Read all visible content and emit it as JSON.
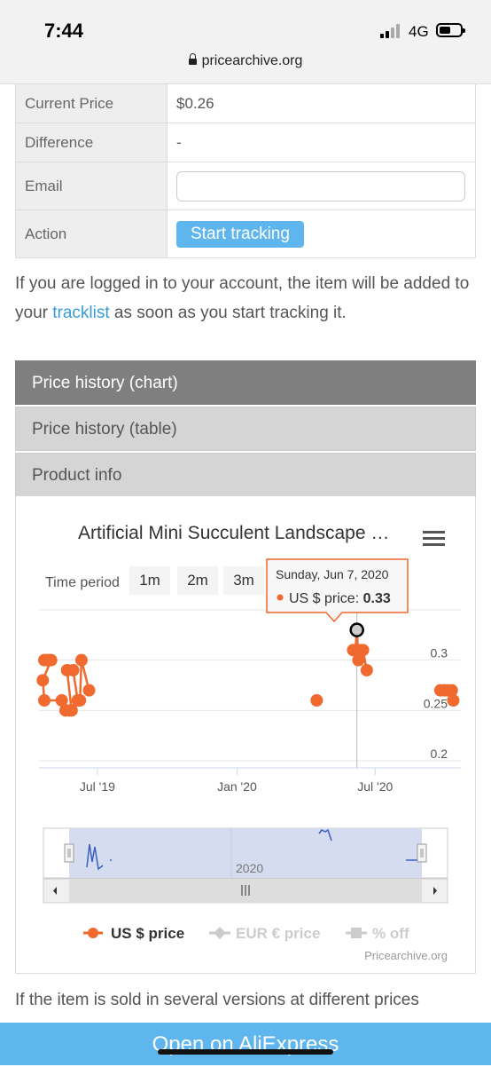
{
  "status": {
    "time": "7:44",
    "network": "4G",
    "url": "pricearchive.org"
  },
  "info_table": [
    {
      "label": "Current Price",
      "value": "$0.26"
    },
    {
      "label": "Difference",
      "value": "-"
    },
    {
      "label": "Email",
      "value": ""
    },
    {
      "label": "Action",
      "button": "Start tracking"
    }
  ],
  "intro": {
    "before": "If you are logged in to your account, the item will be added to your ",
    "link": "tracklist",
    "after": " as soon as you start tracking it."
  },
  "tabs": [
    "Price history (chart)",
    "Price history (table)",
    "Product info"
  ],
  "chart": {
    "title": "Artificial Mini Succulent Landscape …",
    "time_period_label": "Time period",
    "periods": [
      "1m",
      "2m",
      "3m"
    ],
    "tooltip": {
      "date": "Sunday, Jun 7, 2020",
      "series": "US $ price: ",
      "value": "0.33"
    },
    "navigator_label": "2020",
    "legend": [
      "US $ price",
      "EUR € price",
      "% off"
    ],
    "credit": "Pricearchive.org",
    "colors": {
      "us": "#f0692f",
      "inactive": "#cccccc",
      "navigator": "#d6dcf0",
      "navline": "#3b5fbf"
    }
  },
  "chart_data": {
    "type": "scatter",
    "title": "Artificial Mini Succulent Landscape …",
    "x_tick_labels": [
      "Jul '19",
      "Jan '20",
      "Jul '20"
    ],
    "y_tick_labels": [
      "0.2",
      "0.25",
      "0.3"
    ],
    "ylim": [
      0.2,
      0.35
    ],
    "series": [
      {
        "name": "US $ price",
        "points": [
          [
            "2019-04-22",
            0.3
          ],
          [
            "2019-04-25",
            0.3
          ],
          [
            "2019-04-28",
            0.3
          ],
          [
            "2019-05-01",
            0.3
          ],
          [
            "2019-04-20",
            0.28
          ],
          [
            "2019-04-22",
            0.26
          ],
          [
            "2019-05-15",
            0.26
          ],
          [
            "2019-05-20",
            0.25
          ],
          [
            "2019-05-25",
            0.25
          ],
          [
            "2019-05-28",
            0.25
          ],
          [
            "2019-05-22",
            0.29
          ],
          [
            "2019-05-30",
            0.29
          ],
          [
            "2019-06-05",
            0.26
          ],
          [
            "2019-06-08",
            0.26
          ],
          [
            "2019-06-10",
            0.3
          ],
          [
            "2019-06-20",
            0.27
          ],
          [
            "2020-04-15",
            0.26
          ],
          [
            "2020-06-02",
            0.31
          ],
          [
            "2020-06-05",
            0.31
          ],
          [
            "2020-06-07",
            0.33
          ],
          [
            "2020-06-09",
            0.3
          ],
          [
            "2020-06-12",
            0.31
          ],
          [
            "2020-06-15",
            0.31
          ],
          [
            "2020-06-20",
            0.29
          ],
          [
            "2020-09-25",
            0.27
          ],
          [
            "2020-09-30",
            0.27
          ],
          [
            "2020-10-05",
            0.27
          ],
          [
            "2020-10-10",
            0.27
          ],
          [
            "2020-10-12",
            0.26
          ]
        ]
      }
    ],
    "highlight": {
      "x": "2020-06-07",
      "y": 0.33
    }
  },
  "footer_text": "If the item is sold in several versions at different prices",
  "cta": "Open on AliExpress"
}
